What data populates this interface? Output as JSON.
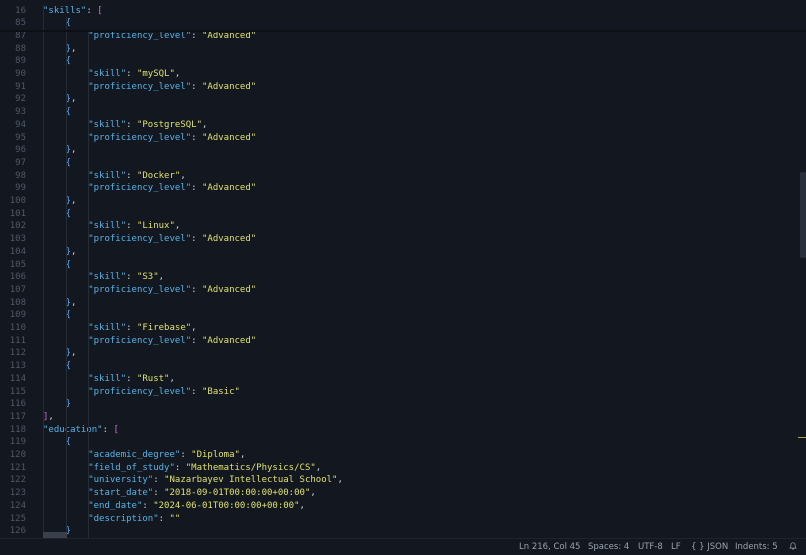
{
  "editor": {
    "lines": [
      {
        "n": "16",
        "indent": 1,
        "tokens": [
          {
            "t": "k",
            "v": "\"skills\""
          },
          {
            "t": "p",
            "v": ": "
          },
          {
            "t": "b2",
            "v": "["
          }
        ]
      },
      {
        "n": "85",
        "indent": 2,
        "tokens": [
          {
            "t": "b3",
            "v": "{"
          }
        ]
      },
      {
        "n": "87",
        "indent": 3,
        "tokens": [
          {
            "t": "k",
            "v": "\"proficiency_level\""
          },
          {
            "t": "p",
            "v": ": "
          },
          {
            "t": "s",
            "v": "\"Advanced\""
          }
        ]
      },
      {
        "n": "88",
        "indent": 2,
        "tokens": [
          {
            "t": "b3",
            "v": "}"
          },
          {
            "t": "p",
            "v": ","
          }
        ]
      },
      {
        "n": "89",
        "indent": 2,
        "tokens": [
          {
            "t": "b3",
            "v": "{"
          }
        ]
      },
      {
        "n": "90",
        "indent": 3,
        "tokens": [
          {
            "t": "k",
            "v": "\"skill\""
          },
          {
            "t": "p",
            "v": ": "
          },
          {
            "t": "s",
            "v": "\"mySQL\""
          },
          {
            "t": "p",
            "v": ","
          }
        ]
      },
      {
        "n": "91",
        "indent": 3,
        "tokens": [
          {
            "t": "k",
            "v": "\"proficiency_level\""
          },
          {
            "t": "p",
            "v": ": "
          },
          {
            "t": "s",
            "v": "\"Advanced\""
          }
        ]
      },
      {
        "n": "92",
        "indent": 2,
        "tokens": [
          {
            "t": "b3",
            "v": "}"
          },
          {
            "t": "p",
            "v": ","
          }
        ]
      },
      {
        "n": "93",
        "indent": 2,
        "tokens": [
          {
            "t": "b3",
            "v": "{"
          }
        ]
      },
      {
        "n": "94",
        "indent": 3,
        "tokens": [
          {
            "t": "k",
            "v": "\"skill\""
          },
          {
            "t": "p",
            "v": ": "
          },
          {
            "t": "s",
            "v": "\"PostgreSQL\""
          },
          {
            "t": "p",
            "v": ","
          }
        ]
      },
      {
        "n": "95",
        "indent": 3,
        "tokens": [
          {
            "t": "k",
            "v": "\"proficiency_level\""
          },
          {
            "t": "p",
            "v": ": "
          },
          {
            "t": "s",
            "v": "\"Advanced\""
          }
        ]
      },
      {
        "n": "96",
        "indent": 2,
        "tokens": [
          {
            "t": "b3",
            "v": "}"
          },
          {
            "t": "p",
            "v": ","
          }
        ]
      },
      {
        "n": "97",
        "indent": 2,
        "tokens": [
          {
            "t": "b3",
            "v": "{"
          }
        ]
      },
      {
        "n": "98",
        "indent": 3,
        "tokens": [
          {
            "t": "k",
            "v": "\"skill\""
          },
          {
            "t": "p",
            "v": ": "
          },
          {
            "t": "s",
            "v": "\"Docker\""
          },
          {
            "t": "p",
            "v": ","
          }
        ]
      },
      {
        "n": "99",
        "indent": 3,
        "tokens": [
          {
            "t": "k",
            "v": "\"proficiency_level\""
          },
          {
            "t": "p",
            "v": ": "
          },
          {
            "t": "s",
            "v": "\"Advanced\""
          }
        ]
      },
      {
        "n": "100",
        "indent": 2,
        "tokens": [
          {
            "t": "b3",
            "v": "}"
          },
          {
            "t": "p",
            "v": ","
          }
        ]
      },
      {
        "n": "101",
        "indent": 2,
        "tokens": [
          {
            "t": "b3",
            "v": "{"
          }
        ]
      },
      {
        "n": "102",
        "indent": 3,
        "tokens": [
          {
            "t": "k",
            "v": "\"skill\""
          },
          {
            "t": "p",
            "v": ": "
          },
          {
            "t": "s",
            "v": "\"Linux\""
          },
          {
            "t": "p",
            "v": ","
          }
        ]
      },
      {
        "n": "103",
        "indent": 3,
        "tokens": [
          {
            "t": "k",
            "v": "\"proficiency_level\""
          },
          {
            "t": "p",
            "v": ": "
          },
          {
            "t": "s",
            "v": "\"Advanced\""
          }
        ]
      },
      {
        "n": "104",
        "indent": 2,
        "tokens": [
          {
            "t": "b3",
            "v": "}"
          },
          {
            "t": "p",
            "v": ","
          }
        ]
      },
      {
        "n": "105",
        "indent": 2,
        "tokens": [
          {
            "t": "b3",
            "v": "{"
          }
        ]
      },
      {
        "n": "106",
        "indent": 3,
        "tokens": [
          {
            "t": "k",
            "v": "\"skill\""
          },
          {
            "t": "p",
            "v": ": "
          },
          {
            "t": "s",
            "v": "\"S3\""
          },
          {
            "t": "p",
            "v": ","
          }
        ]
      },
      {
        "n": "107",
        "indent": 3,
        "tokens": [
          {
            "t": "k",
            "v": "\"proficiency_level\""
          },
          {
            "t": "p",
            "v": ": "
          },
          {
            "t": "s",
            "v": "\"Advanced\""
          }
        ]
      },
      {
        "n": "108",
        "indent": 2,
        "tokens": [
          {
            "t": "b3",
            "v": "}"
          },
          {
            "t": "p",
            "v": ","
          }
        ]
      },
      {
        "n": "109",
        "indent": 2,
        "tokens": [
          {
            "t": "b3",
            "v": "{"
          }
        ]
      },
      {
        "n": "110",
        "indent": 3,
        "tokens": [
          {
            "t": "k",
            "v": "\"skill\""
          },
          {
            "t": "p",
            "v": ": "
          },
          {
            "t": "s",
            "v": "\"Firebase\""
          },
          {
            "t": "p",
            "v": ","
          }
        ]
      },
      {
        "n": "111",
        "indent": 3,
        "tokens": [
          {
            "t": "k",
            "v": "\"proficiency_level\""
          },
          {
            "t": "p",
            "v": ": "
          },
          {
            "t": "s",
            "v": "\"Advanced\""
          }
        ]
      },
      {
        "n": "112",
        "indent": 2,
        "tokens": [
          {
            "t": "b3",
            "v": "}"
          },
          {
            "t": "p",
            "v": ","
          }
        ]
      },
      {
        "n": "113",
        "indent": 2,
        "tokens": [
          {
            "t": "b3",
            "v": "{"
          }
        ]
      },
      {
        "n": "114",
        "indent": 3,
        "tokens": [
          {
            "t": "k",
            "v": "\"skill\""
          },
          {
            "t": "p",
            "v": ": "
          },
          {
            "t": "s",
            "v": "\"Rust\""
          },
          {
            "t": "p",
            "v": ","
          }
        ]
      },
      {
        "n": "115",
        "indent": 3,
        "tokens": [
          {
            "t": "k",
            "v": "\"proficiency_level\""
          },
          {
            "t": "p",
            "v": ": "
          },
          {
            "t": "s",
            "v": "\"Basic\""
          }
        ]
      },
      {
        "n": "116",
        "indent": 2,
        "tokens": [
          {
            "t": "b3",
            "v": "}"
          }
        ]
      },
      {
        "n": "117",
        "indent": 1,
        "tokens": [
          {
            "t": "b2",
            "v": "]"
          },
          {
            "t": "p",
            "v": ","
          }
        ]
      },
      {
        "n": "118",
        "indent": 1,
        "tokens": [
          {
            "t": "k",
            "v": "\"education\""
          },
          {
            "t": "p",
            "v": ": "
          },
          {
            "t": "b2",
            "v": "["
          }
        ]
      },
      {
        "n": "119",
        "indent": 2,
        "tokens": [
          {
            "t": "b3",
            "v": "{"
          }
        ]
      },
      {
        "n": "120",
        "indent": 3,
        "tokens": [
          {
            "t": "k",
            "v": "\"academic_degree\""
          },
          {
            "t": "p",
            "v": ": "
          },
          {
            "t": "s",
            "v": "\"Diploma\""
          },
          {
            "t": "p",
            "v": ","
          }
        ]
      },
      {
        "n": "121",
        "indent": 3,
        "tokens": [
          {
            "t": "k",
            "v": "\"field_of_study\""
          },
          {
            "t": "p",
            "v": ": "
          },
          {
            "t": "s",
            "v": "\"Mathematics/Physics/CS\""
          },
          {
            "t": "p",
            "v": ","
          }
        ]
      },
      {
        "n": "122",
        "indent": 3,
        "tokens": [
          {
            "t": "k",
            "v": "\"university\""
          },
          {
            "t": "p",
            "v": ": "
          },
          {
            "t": "s",
            "v": "\"Nazarbayev Intellectual School\""
          },
          {
            "t": "p",
            "v": ","
          }
        ]
      },
      {
        "n": "123",
        "indent": 3,
        "tokens": [
          {
            "t": "k",
            "v": "\"start_date\""
          },
          {
            "t": "p",
            "v": ": "
          },
          {
            "t": "s",
            "v": "\"2018-09-01T00:00:00+00:00\""
          },
          {
            "t": "p",
            "v": ","
          }
        ]
      },
      {
        "n": "124",
        "indent": 3,
        "tokens": [
          {
            "t": "k",
            "v": "\"end_date\""
          },
          {
            "t": "p",
            "v": ": "
          },
          {
            "t": "s",
            "v": "\"2024-06-01T00:00:00+00:00\""
          },
          {
            "t": "p",
            "v": ","
          }
        ]
      },
      {
        "n": "125",
        "indent": 3,
        "tokens": [
          {
            "t": "k",
            "v": "\"description\""
          },
          {
            "t": "p",
            "v": ": "
          },
          {
            "t": "s",
            "v": "\"\""
          }
        ]
      },
      {
        "n": "126",
        "indent": 2,
        "tokens": [
          {
            "t": "b3",
            "v": "}"
          }
        ]
      }
    ]
  },
  "statusbar": {
    "cursor": "Ln 216, Col 45",
    "spaces": "Spaces: 4",
    "encoding": "UTF-8",
    "eol": "LF",
    "language_icon": "{ }",
    "language": "JSON",
    "indents": "Indents: 5",
    "bell_icon": "bell-icon"
  },
  "colors": {
    "background": "#13171f",
    "key": "#56b4e9",
    "string": "#dfe36a",
    "bracket_square": "#d36ad6",
    "bracket_curly": "#5aa8f0",
    "line_number": "#4f5866"
  }
}
